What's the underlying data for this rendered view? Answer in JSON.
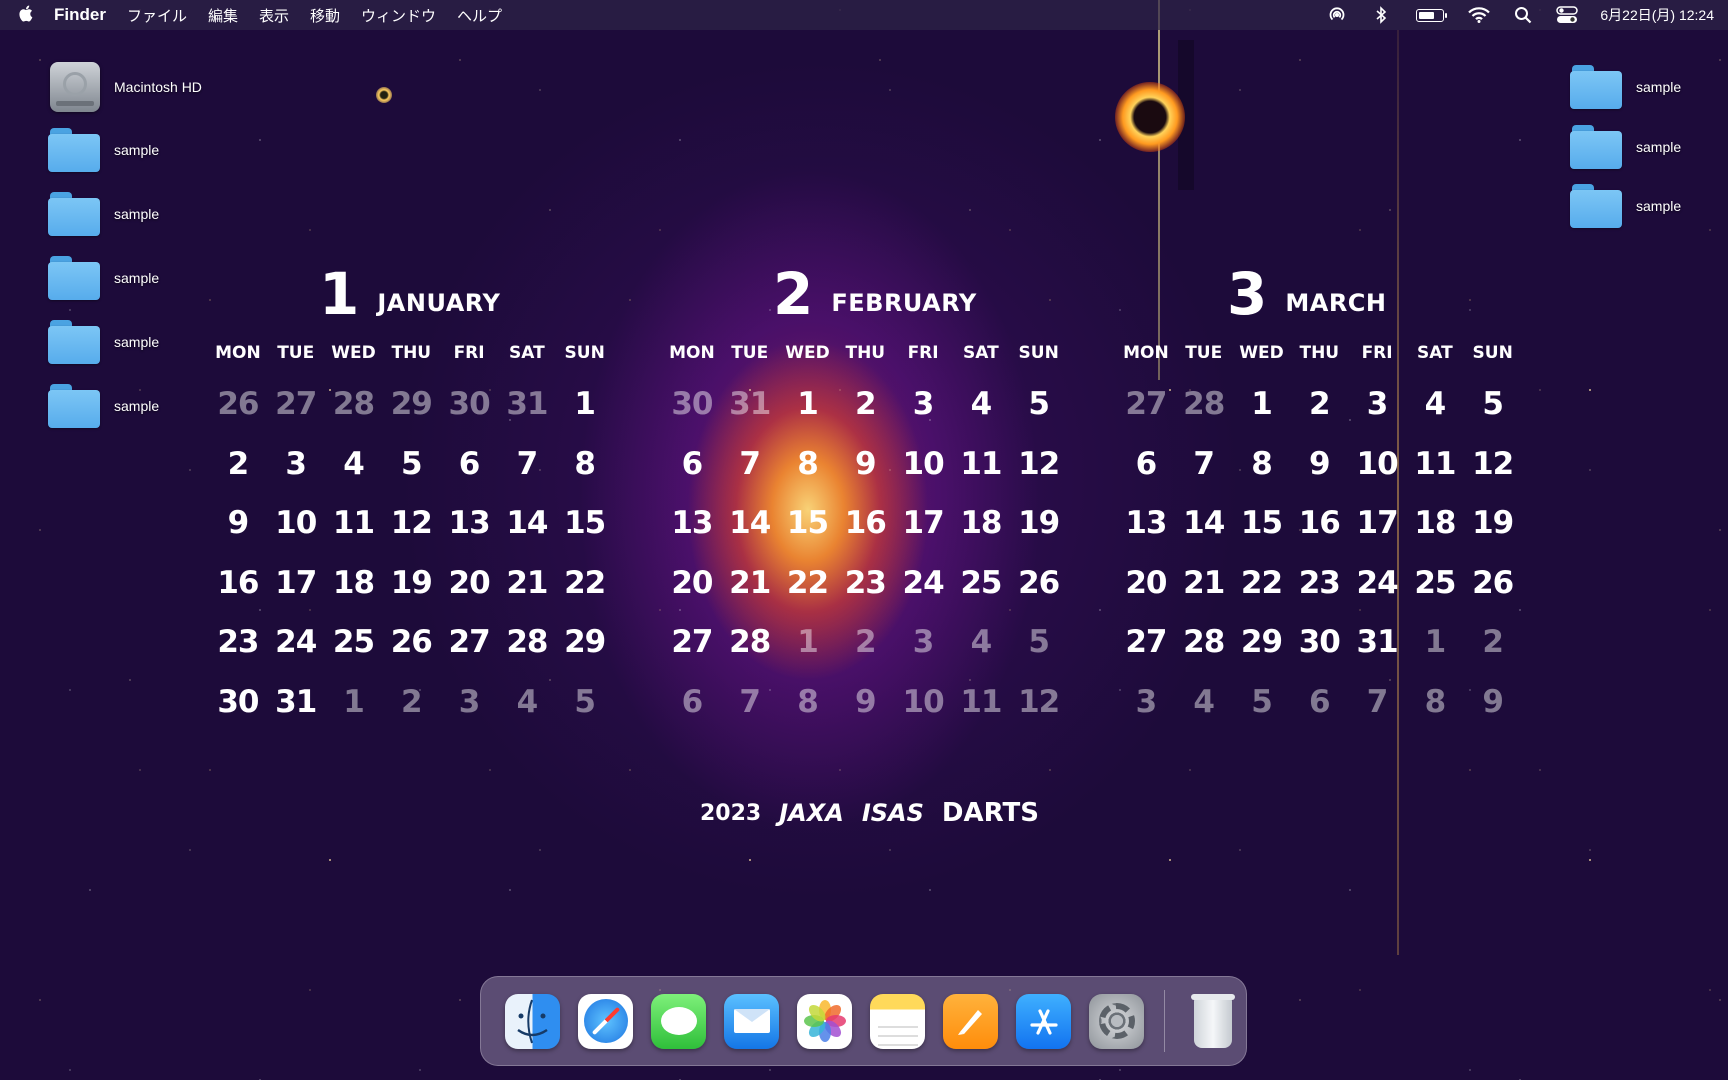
{
  "menubar": {
    "apple_icon": "apple-logo",
    "app_name": "Finder",
    "menus": [
      "ファイル",
      "編集",
      "表示",
      "移動",
      "ウィンドウ",
      "ヘルプ"
    ],
    "status_icons": [
      "airdrop-icon",
      "bluetooth-icon",
      "battery-icon",
      "wifi-icon",
      "search-icon",
      "control-center-icon"
    ],
    "datetime": "6月22日(月) 12:24"
  },
  "desktop_left": [
    {
      "label": "Macintosh HD",
      "icon": "hard-drive-icon"
    },
    {
      "label": "sample",
      "icon": "folder-icon"
    },
    {
      "label": "sample",
      "icon": "folder-icon"
    },
    {
      "label": "sample",
      "icon": "folder-icon"
    },
    {
      "label": "sample",
      "icon": "folder-icon"
    },
    {
      "label": "sample",
      "icon": "folder-icon"
    }
  ],
  "desktop_right": [
    {
      "label": "sample",
      "icon": "folder-icon"
    },
    {
      "label": "sample",
      "icon": "folder-icon"
    },
    {
      "label": "sample",
      "icon": "folder-icon"
    }
  ],
  "calendar": {
    "weekdays": [
      "MON",
      "TUE",
      "WED",
      "THU",
      "FRI",
      "SAT",
      "SUN"
    ],
    "months": [
      {
        "number": "1",
        "name": "JANUARY",
        "days": [
          "26",
          "27",
          "28",
          "29",
          "30",
          "31",
          "1",
          "2",
          "3",
          "4",
          "5",
          "6",
          "7",
          "8",
          "9",
          "10",
          "11",
          "12",
          "13",
          "14",
          "15",
          "16",
          "17",
          "18",
          "19",
          "20",
          "21",
          "22",
          "23",
          "24",
          "25",
          "26",
          "27",
          "28",
          "29",
          "30",
          "31",
          "1",
          "2",
          "3",
          "4",
          "5"
        ],
        "dim_before": 6,
        "dim_after": 5
      },
      {
        "number": "2",
        "name": "FEBRUARY",
        "days": [
          "30",
          "31",
          "1",
          "2",
          "3",
          "4",
          "5",
          "6",
          "7",
          "8",
          "9",
          "10",
          "11",
          "12",
          "13",
          "14",
          "15",
          "16",
          "17",
          "18",
          "19",
          "20",
          "21",
          "22",
          "23",
          "24",
          "25",
          "26",
          "27",
          "28",
          "1",
          "2",
          "3",
          "4",
          "5",
          "6",
          "7",
          "8",
          "9",
          "10",
          "11",
          "12"
        ],
        "dim_before": 2,
        "dim_after": 12
      },
      {
        "number": "3",
        "name": "MARCH",
        "days": [
          "27",
          "28",
          "1",
          "2",
          "3",
          "4",
          "5",
          "6",
          "7",
          "8",
          "9",
          "10",
          "11",
          "12",
          "13",
          "14",
          "15",
          "16",
          "17",
          "18",
          "19",
          "20",
          "21",
          "22",
          "23",
          "24",
          "25",
          "26",
          "27",
          "28",
          "29",
          "30",
          "31",
          "1",
          "2",
          "3",
          "4",
          "5",
          "6",
          "7",
          "8",
          "9"
        ],
        "dim_before": 2,
        "dim_after": 9
      }
    ],
    "footer": {
      "year": "2023",
      "logo1": "JAXA",
      "logo2": "ISAS",
      "logo3": "DARTS"
    }
  },
  "dock": [
    {
      "name": "finder",
      "icon": "finder-icon"
    },
    {
      "name": "safari",
      "icon": "safari-icon"
    },
    {
      "name": "messages",
      "icon": "messages-icon"
    },
    {
      "name": "mail",
      "icon": "mail-icon"
    },
    {
      "name": "photos",
      "icon": "photos-icon"
    },
    {
      "name": "notes",
      "icon": "notes-icon"
    },
    {
      "name": "pages",
      "icon": "pages-icon"
    },
    {
      "name": "app-store",
      "icon": "app-store-icon"
    },
    {
      "name": "system-preferences",
      "icon": "system-preferences-icon"
    },
    {
      "name": "trash",
      "icon": "trash-icon"
    }
  ]
}
